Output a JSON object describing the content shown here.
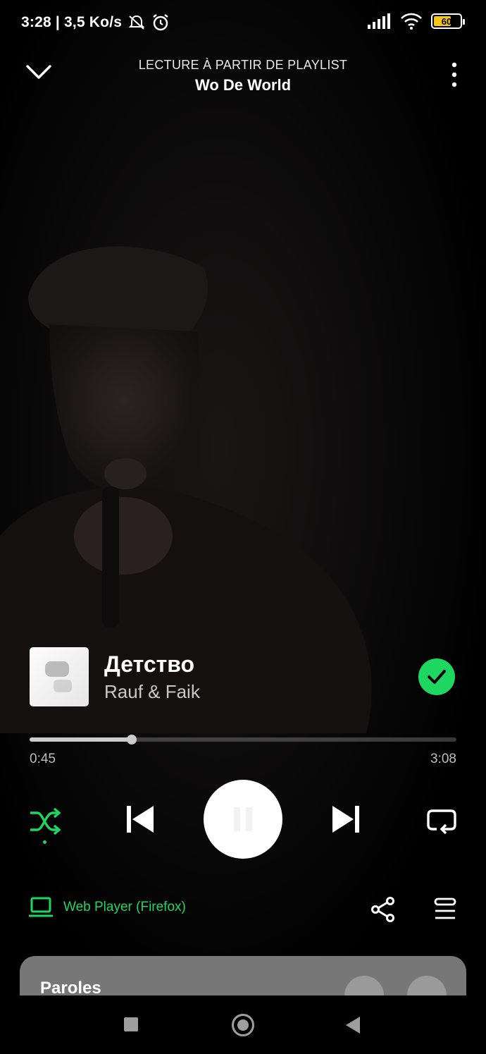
{
  "status_bar": {
    "time_speed": "3:28 | 3,5 Ko/s",
    "battery": "60"
  },
  "header": {
    "context": "LECTURE À PARTIR DE PLAYLIST",
    "playlist": "Wo De World",
    "icons": {
      "collapse": "chevron-down-icon",
      "menu": "more-vertical-icon"
    }
  },
  "track": {
    "title": "Детство",
    "artist": "Rauf & Faik",
    "liked": true
  },
  "progress": {
    "elapsed": "0:45",
    "total": "3:08",
    "fraction": 0.24
  },
  "controls": {
    "shuffle_active": true,
    "state": "playing"
  },
  "device": {
    "label": "Web Player (Firefox)"
  },
  "lyrics": {
    "label": "Paroles"
  },
  "colors": {
    "accent": "#1ed760",
    "background": "#000000",
    "card": "#777777"
  }
}
